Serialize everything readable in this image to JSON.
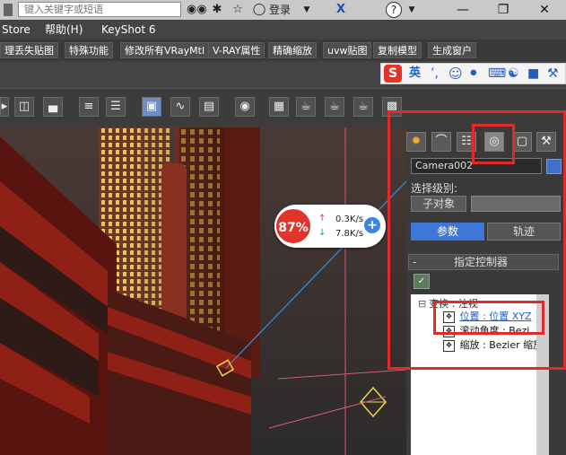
{
  "titlebar": {
    "search_placeholder": "键入关键字或短语",
    "login_label": "登录",
    "help_glyph": "?",
    "icons": [
      "binoculars-icon",
      "star-icon",
      "user-icon",
      "x-icon",
      "help-icon"
    ],
    "window_buttons": [
      "—",
      "❐",
      "✕"
    ]
  },
  "menubar": {
    "items": [
      "Store",
      "帮助(H)",
      "KeyShot 6"
    ]
  },
  "pluginbar": {
    "buttons": [
      "理丢失贴图",
      "特殊功能",
      "修改所有VRayMtl",
      "V-RAY属性",
      "精确缩放",
      "uvw贴图",
      "复制模型",
      "生成窗户"
    ]
  },
  "ime": {
    "label": "英",
    "icons": [
      "sogou-s-icon",
      "comma-icon",
      "smiley-icon",
      "mic-icon",
      "keyboard-icon",
      "share-icon",
      "shirt-icon",
      "wrench-icon"
    ]
  },
  "speed_widget": {
    "percent": "87%",
    "upload": "0.3K/s",
    "download": "7.8K/s"
  },
  "command_panel": {
    "camera_name": "Camera002",
    "selection_level_label": "选择级别:",
    "sub_object_button": "子对象",
    "params_button": "参数",
    "motion_button": "轨迹",
    "rollout_title": "指定控制器",
    "rollout_toggle": "-",
    "tree": [
      {
        "label": "变换 : 注视",
        "indent": 0
      },
      {
        "label": "位置 : 位置 XYZ",
        "indent": 1,
        "selected": true
      },
      {
        "label": "滚动角度 : Bezi",
        "indent": 1
      },
      {
        "label": "缩放 : Bezier 缩放",
        "indent": 1
      }
    ]
  },
  "colors": {
    "accent_blue": "#3d78d8",
    "highlight_red": "#e12b2b",
    "camera_color": "#3f6fd1"
  }
}
